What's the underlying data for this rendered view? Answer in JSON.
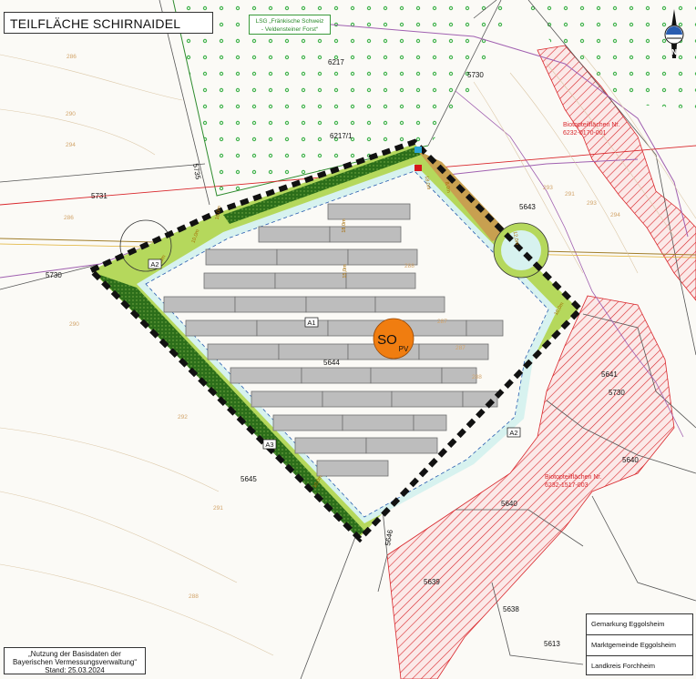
{
  "title": "TEILFLÄCHE SCHIRNAIDEL",
  "lsg": {
    "line1": "LSG „Fränkische Schweiz",
    "line2": "- Veldensteiner Forst“"
  },
  "source": {
    "line1": "„Nutzung der Basisdaten der",
    "line2": "Bayerischen Vermessungsverwaltung“",
    "line3": "Stand: 25.03.2024"
  },
  "legend": [
    "Gemarkung Eggolsheim",
    "Marktgemeinde Eggolsheim",
    "Landkreis Forchheim"
  ],
  "biotope1": {
    "line1": "Biotopteilflächen Nr.",
    "line2": "6232-0170-001"
  },
  "biotope2": {
    "line1": "Biotopteilflächen Nr.",
    "line2": "6232-1517-003"
  },
  "parcels": [
    "6217",
    "5730",
    "6217/1",
    "5731",
    "5730",
    "5643",
    "5644",
    "5641",
    "5730",
    "5640",
    "5640",
    "5645",
    "5639",
    "5638",
    "5613",
    "5735",
    "5646"
  ],
  "zone_labels": [
    "A1",
    "A2",
    "A2",
    "A3"
  ],
  "so_label": {
    "main": "SO",
    "sub": "PV"
  },
  "dimensions": [
    "10,0m",
    "18,0m",
    "15,0m",
    "10,0m",
    "10,0m",
    "18,0m",
    "8,0m",
    "12,0m",
    "10,0m",
    "10,0m"
  ],
  "contours": [
    "286",
    "290",
    "294",
    "286",
    "290",
    "292",
    "291",
    "288",
    "288",
    "287",
    "287",
    "288",
    "293",
    "291",
    "293",
    "294"
  ],
  "colors": {
    "background": "#fbfaf6",
    "buffer_green": "#b5d85c",
    "hedge_green": "#2c6e1a",
    "pv_panel": "#bdbdbd",
    "so_orange": "#f07d10",
    "biotope_red": "#d9262b",
    "boundary_black": "#111111",
    "contour": "#d2a46a"
  }
}
